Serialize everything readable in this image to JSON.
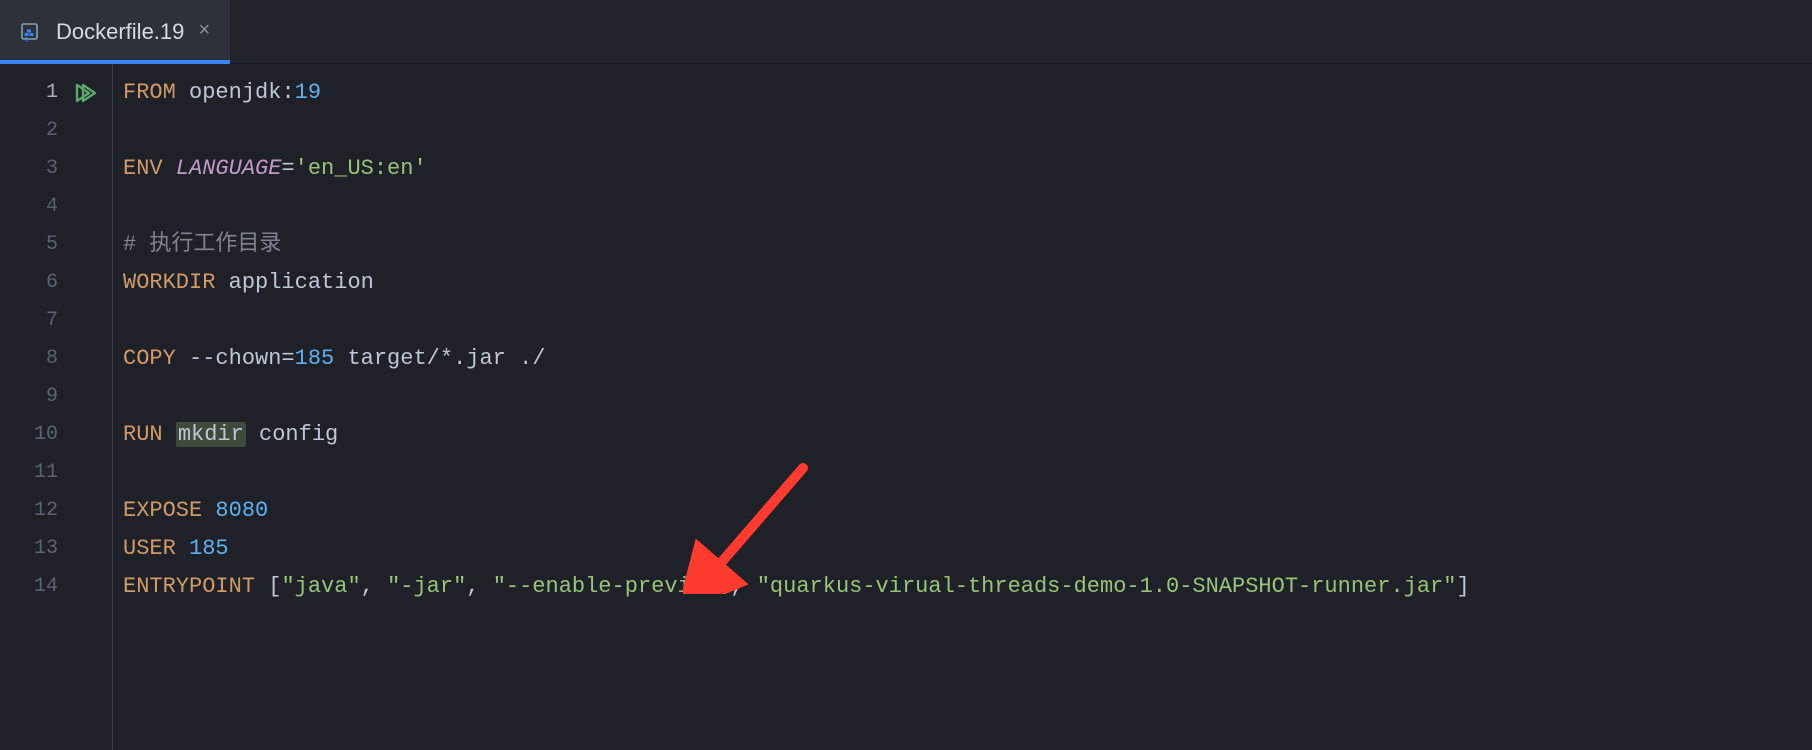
{
  "tab": {
    "filename": "Dockerfile.19"
  },
  "gutter": {
    "lines": [
      "1",
      "2",
      "3",
      "4",
      "5",
      "6",
      "7",
      "8",
      "9",
      "10",
      "11",
      "12",
      "13",
      "14"
    ],
    "current": 1
  },
  "code": {
    "l1": {
      "kw": "FROM",
      "image": "openjdk",
      "tag": "19"
    },
    "l3": {
      "kw": "ENV",
      "var": "LANGUAGE",
      "eq": "=",
      "val": "'en_US:en'"
    },
    "l5": {
      "comment": "# 执行工作目录"
    },
    "l6": {
      "kw": "WORKDIR",
      "path": "application"
    },
    "l8": {
      "kw": "COPY",
      "flag": "--chown=",
      "flagnum": "185",
      "src": "target/",
      "glob": "*",
      "ext": ".jar",
      "dst": "./"
    },
    "l10": {
      "kw": "RUN",
      "cmd": "mkdir",
      "arg": "config"
    },
    "l12": {
      "kw": "EXPOSE",
      "port": "8080"
    },
    "l13": {
      "kw": "USER",
      "uid": "185"
    },
    "l14": {
      "kw": "ENTRYPOINT",
      "open": "[",
      "a0": "\"java\"",
      "c0": ", ",
      "a1": "\"-jar\"",
      "c1": ", ",
      "a2": "\"--enable-preview\"",
      "c2": ", ",
      "a3": "\"quarkus-virual-threads-demo-1.0-SNAPSHOT-runner.jar\"",
      "close": "]"
    }
  }
}
